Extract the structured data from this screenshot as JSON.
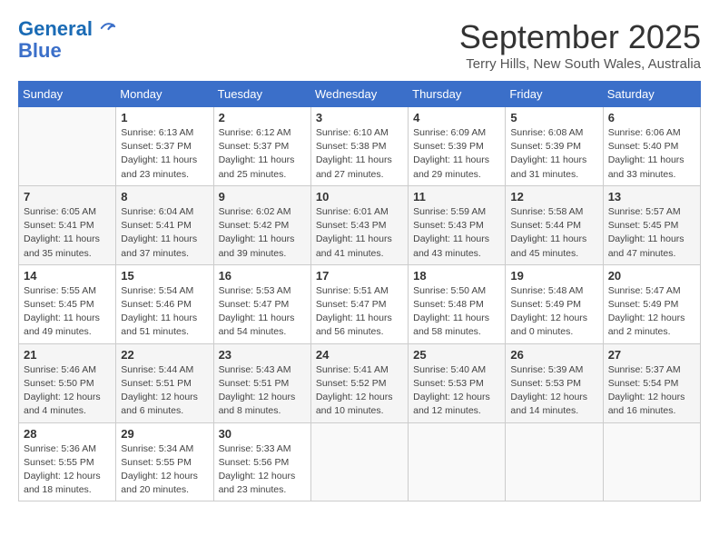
{
  "header": {
    "logo_line1": "General",
    "logo_line2": "Blue",
    "month": "September 2025",
    "location": "Terry Hills, New South Wales, Australia"
  },
  "days_of_week": [
    "Sunday",
    "Monday",
    "Tuesday",
    "Wednesday",
    "Thursday",
    "Friday",
    "Saturday"
  ],
  "weeks": [
    [
      {
        "day": "",
        "info": ""
      },
      {
        "day": "1",
        "info": "Sunrise: 6:13 AM\nSunset: 5:37 PM\nDaylight: 11 hours\nand 23 minutes."
      },
      {
        "day": "2",
        "info": "Sunrise: 6:12 AM\nSunset: 5:37 PM\nDaylight: 11 hours\nand 25 minutes."
      },
      {
        "day": "3",
        "info": "Sunrise: 6:10 AM\nSunset: 5:38 PM\nDaylight: 11 hours\nand 27 minutes."
      },
      {
        "day": "4",
        "info": "Sunrise: 6:09 AM\nSunset: 5:39 PM\nDaylight: 11 hours\nand 29 minutes."
      },
      {
        "day": "5",
        "info": "Sunrise: 6:08 AM\nSunset: 5:39 PM\nDaylight: 11 hours\nand 31 minutes."
      },
      {
        "day": "6",
        "info": "Sunrise: 6:06 AM\nSunset: 5:40 PM\nDaylight: 11 hours\nand 33 minutes."
      }
    ],
    [
      {
        "day": "7",
        "info": "Sunrise: 6:05 AM\nSunset: 5:41 PM\nDaylight: 11 hours\nand 35 minutes."
      },
      {
        "day": "8",
        "info": "Sunrise: 6:04 AM\nSunset: 5:41 PM\nDaylight: 11 hours\nand 37 minutes."
      },
      {
        "day": "9",
        "info": "Sunrise: 6:02 AM\nSunset: 5:42 PM\nDaylight: 11 hours\nand 39 minutes."
      },
      {
        "day": "10",
        "info": "Sunrise: 6:01 AM\nSunset: 5:43 PM\nDaylight: 11 hours\nand 41 minutes."
      },
      {
        "day": "11",
        "info": "Sunrise: 5:59 AM\nSunset: 5:43 PM\nDaylight: 11 hours\nand 43 minutes."
      },
      {
        "day": "12",
        "info": "Sunrise: 5:58 AM\nSunset: 5:44 PM\nDaylight: 11 hours\nand 45 minutes."
      },
      {
        "day": "13",
        "info": "Sunrise: 5:57 AM\nSunset: 5:45 PM\nDaylight: 11 hours\nand 47 minutes."
      }
    ],
    [
      {
        "day": "14",
        "info": "Sunrise: 5:55 AM\nSunset: 5:45 PM\nDaylight: 11 hours\nand 49 minutes."
      },
      {
        "day": "15",
        "info": "Sunrise: 5:54 AM\nSunset: 5:46 PM\nDaylight: 11 hours\nand 51 minutes."
      },
      {
        "day": "16",
        "info": "Sunrise: 5:53 AM\nSunset: 5:47 PM\nDaylight: 11 hours\nand 54 minutes."
      },
      {
        "day": "17",
        "info": "Sunrise: 5:51 AM\nSunset: 5:47 PM\nDaylight: 11 hours\nand 56 minutes."
      },
      {
        "day": "18",
        "info": "Sunrise: 5:50 AM\nSunset: 5:48 PM\nDaylight: 11 hours\nand 58 minutes."
      },
      {
        "day": "19",
        "info": "Sunrise: 5:48 AM\nSunset: 5:49 PM\nDaylight: 12 hours\nand 0 minutes."
      },
      {
        "day": "20",
        "info": "Sunrise: 5:47 AM\nSunset: 5:49 PM\nDaylight: 12 hours\nand 2 minutes."
      }
    ],
    [
      {
        "day": "21",
        "info": "Sunrise: 5:46 AM\nSunset: 5:50 PM\nDaylight: 12 hours\nand 4 minutes."
      },
      {
        "day": "22",
        "info": "Sunrise: 5:44 AM\nSunset: 5:51 PM\nDaylight: 12 hours\nand 6 minutes."
      },
      {
        "day": "23",
        "info": "Sunrise: 5:43 AM\nSunset: 5:51 PM\nDaylight: 12 hours\nand 8 minutes."
      },
      {
        "day": "24",
        "info": "Sunrise: 5:41 AM\nSunset: 5:52 PM\nDaylight: 12 hours\nand 10 minutes."
      },
      {
        "day": "25",
        "info": "Sunrise: 5:40 AM\nSunset: 5:53 PM\nDaylight: 12 hours\nand 12 minutes."
      },
      {
        "day": "26",
        "info": "Sunrise: 5:39 AM\nSunset: 5:53 PM\nDaylight: 12 hours\nand 14 minutes."
      },
      {
        "day": "27",
        "info": "Sunrise: 5:37 AM\nSunset: 5:54 PM\nDaylight: 12 hours\nand 16 minutes."
      }
    ],
    [
      {
        "day": "28",
        "info": "Sunrise: 5:36 AM\nSunset: 5:55 PM\nDaylight: 12 hours\nand 18 minutes."
      },
      {
        "day": "29",
        "info": "Sunrise: 5:34 AM\nSunset: 5:55 PM\nDaylight: 12 hours\nand 20 minutes."
      },
      {
        "day": "30",
        "info": "Sunrise: 5:33 AM\nSunset: 5:56 PM\nDaylight: 12 hours\nand 23 minutes."
      },
      {
        "day": "",
        "info": ""
      },
      {
        "day": "",
        "info": ""
      },
      {
        "day": "",
        "info": ""
      },
      {
        "day": "",
        "info": ""
      }
    ]
  ]
}
